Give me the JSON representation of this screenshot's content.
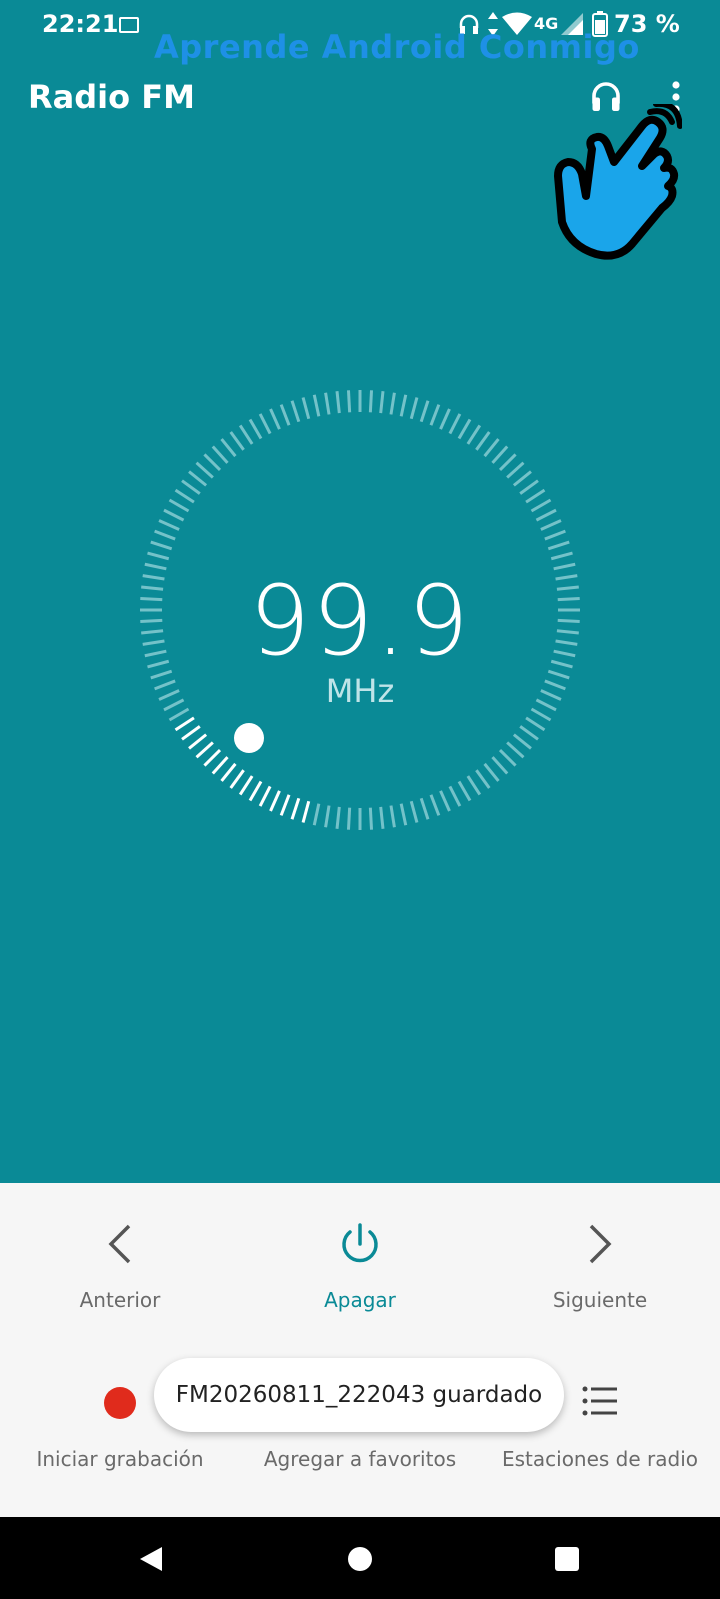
{
  "status": {
    "time": "22:21",
    "network": "4G",
    "battery": "73 %",
    "icons": [
      "sim-icon",
      "headset-icon",
      "data-arrows-icon",
      "wifi-icon",
      "signal-icon",
      "battery-icon"
    ]
  },
  "watermark": "Aprende Android Conmigo",
  "appbar": {
    "title": "Radio FM",
    "actions": [
      "headphones-icon",
      "more-vert-icon"
    ]
  },
  "tuner": {
    "frequency": "99.9",
    "unit": "MHz"
  },
  "controls": {
    "previous": "Anterior",
    "power": "Apagar",
    "next": "Siguiente",
    "record": "Iniciar grabación",
    "favorites": "Agregar a favoritos",
    "stations": "Estaciones de radio"
  },
  "toast": "FM20260811_222043 guardado",
  "colors": {
    "primary": "#0a8a96",
    "record": "#e02b1c",
    "accent": "#0a8a96",
    "panel": "#f6f6f6",
    "hand": "#1aa5ea"
  },
  "navbar": [
    "back-icon",
    "home-icon",
    "recents-icon"
  ]
}
